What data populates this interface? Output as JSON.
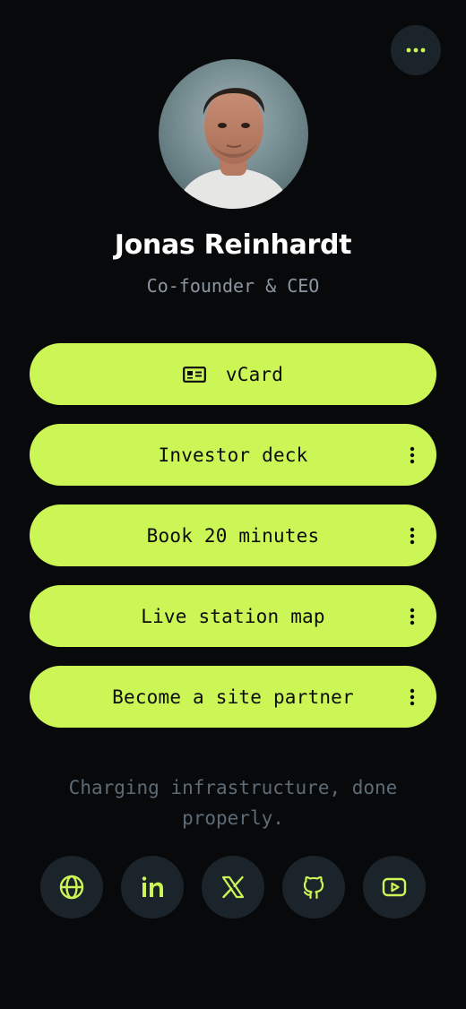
{
  "profile": {
    "name": "Jonas Reinhardt",
    "role": "Co-founder & CEO"
  },
  "links": [
    {
      "label": "vCard",
      "icon": "id-card-icon",
      "has_menu": false
    },
    {
      "label": "Investor deck",
      "has_menu": true
    },
    {
      "label": "Book 20 minutes",
      "has_menu": true
    },
    {
      "label": "Live station map",
      "has_menu": true
    },
    {
      "label": "Become a site partner",
      "has_menu": true
    }
  ],
  "tagline": "Charging infrastructure, done properly.",
  "socials": [
    {
      "icon": "globe-icon"
    },
    {
      "icon": "linkedin-icon"
    },
    {
      "icon": "x-icon"
    },
    {
      "icon": "github-icon"
    },
    {
      "icon": "youtube-icon"
    }
  ],
  "colors": {
    "background": "#08090b",
    "accent": "#ccf656",
    "button_text": "#0b0c0e",
    "muted_text": "#8a96a2",
    "circle_bg": "#1b242b"
  }
}
